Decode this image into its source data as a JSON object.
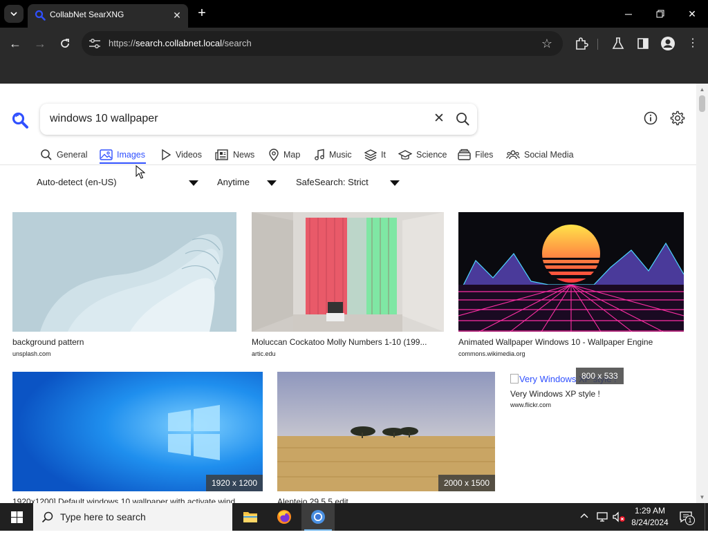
{
  "browser": {
    "tab_title": "CollabNet SearXNG",
    "url_scheme": "https://",
    "url_host": "search.collabnet.local",
    "url_path": "/search"
  },
  "search": {
    "query": "windows 10 wallpaper"
  },
  "categories": [
    {
      "label": "General",
      "icon": "search-icon"
    },
    {
      "label": "Images",
      "icon": "image-icon",
      "active": true
    },
    {
      "label": "Videos",
      "icon": "play-icon"
    },
    {
      "label": "News",
      "icon": "newspaper-icon"
    },
    {
      "label": "Map",
      "icon": "map-pin-icon"
    },
    {
      "label": "Music",
      "icon": "music-icon"
    },
    {
      "label": "It",
      "icon": "layers-icon"
    },
    {
      "label": "Science",
      "icon": "graduation-cap-icon"
    },
    {
      "label": "Files",
      "icon": "files-icon"
    },
    {
      "label": "Social Media",
      "icon": "people-icon"
    }
  ],
  "filters": {
    "language": "Auto-detect (en-US)",
    "time": "Anytime",
    "safesearch": "SafeSearch: Strict"
  },
  "results": [
    {
      "title": "background pattern",
      "source": "unsplash.com"
    },
    {
      "title": "Moluccan Cockatoo Molly Numbers 1-10 (199...",
      "source": "artic.edu"
    },
    {
      "title": "Animated Wallpaper Windows 10 - Wallpaper Engine",
      "source": "commons.wikimedia.org"
    },
    {
      "title": "1920x1200] Default windows 10 wallpaper with activate wind...",
      "source": "",
      "dims": "1920 x 1200"
    },
    {
      "title": "Alentejo 29.5.5 edit",
      "source": "",
      "dims": "2000 x 1500"
    },
    {
      "title": "Very Windows XP style !",
      "source": "www.flickr.com",
      "dims": "800 x 533",
      "alt": "Very Windows XP style !"
    }
  ],
  "taskbar": {
    "search_placeholder": "Type here to search",
    "time": "1:29 AM",
    "date": "8/24/2024",
    "notification_count": "1"
  },
  "colors": {
    "accent": "#3050ff",
    "chrome_dark": "#2a2a2a"
  }
}
